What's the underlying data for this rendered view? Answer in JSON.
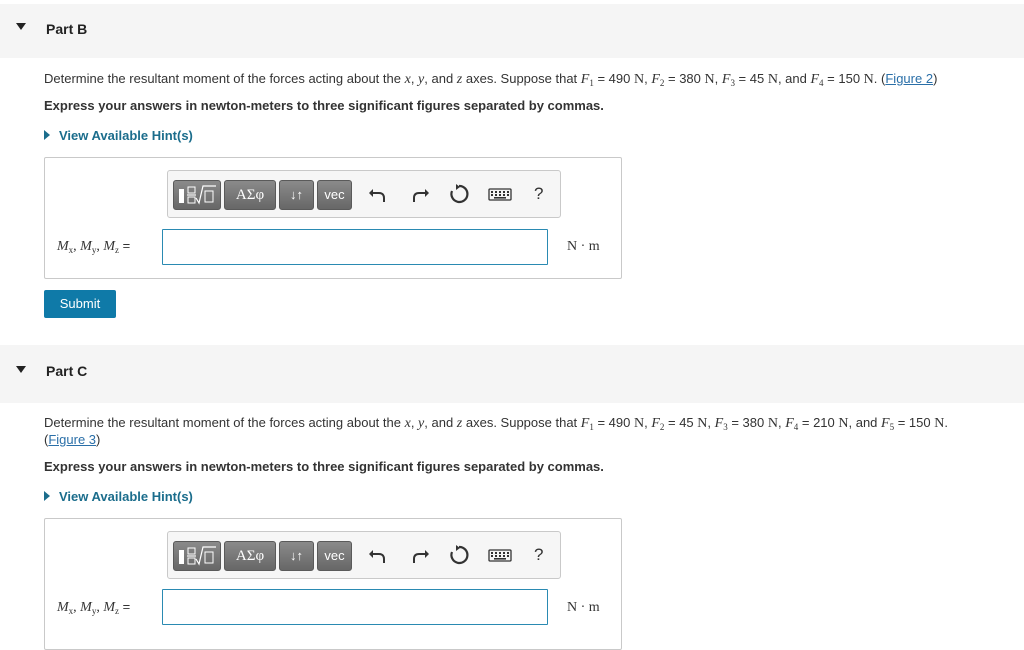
{
  "partB": {
    "title": "Part B",
    "problem": {
      "pre": "Determine the resultant moment of the forces acting about the ",
      "x": "x",
      "comma1": ", ",
      "y": "y",
      "and1": ", and ",
      "z": "z",
      "mid": " axes. Suppose that ",
      "f1": "F",
      "f1sub": "1",
      "f1val": " = 490 ",
      "f2": "F",
      "f2sub": "2",
      "f2val": " = 380 ",
      "f3": "F",
      "f3sub": "3",
      "f3val": " = 45 ",
      "f4": "F",
      "f4sub": "4",
      "f4val": " = 150 ",
      "unitN": "N",
      "sep": ", ",
      "and2": ", and ",
      "end": ". (",
      "figure": "Figure 2",
      "close": ")"
    },
    "instruction": "Express your answers in newton-meters to three significant figures separated by commas.",
    "hint": "View Available Hint(s)",
    "toolbar": {
      "greek": "ΑΣφ",
      "arrows": "↓↑",
      "vec": "vec",
      "help": "?"
    },
    "label": {
      "M": "M",
      "x": "x",
      "y": "y",
      "z": "z",
      "sep": ", ",
      "eq": " ="
    },
    "input_value": "",
    "unit": "N · m",
    "submit": "Submit"
  },
  "partC": {
    "title": "Part C",
    "problem": {
      "pre": "Determine the resultant moment of the forces acting about the ",
      "x": "x",
      "comma1": ", ",
      "y": "y",
      "and1": ", and ",
      "z": "z",
      "mid": " axes. Suppose that ",
      "f1": "F",
      "f1sub": "1",
      "f1val": " = 490 ",
      "f2": "F",
      "f2sub": "2",
      "f2val": " = 45 ",
      "f3": "F",
      "f3sub": "3",
      "f3val": " = 380 ",
      "f4": "F",
      "f4sub": "4",
      "f4val": " = 210 ",
      "f5": "F",
      "f5sub": "5",
      "f5val": " = 150 ",
      "unitN": "N",
      "sep": ", ",
      "and2": ", and ",
      "end": ".",
      "open": "(",
      "figure": "Figure 3",
      "close": ")"
    },
    "instruction": "Express your answers in newton-meters to three significant figures separated by commas.",
    "hint": "View Available Hint(s)",
    "toolbar": {
      "greek": "ΑΣφ",
      "arrows": "↓↑",
      "vec": "vec",
      "help": "?"
    },
    "label": {
      "M": "M",
      "x": "x",
      "y": "y",
      "z": "z",
      "sep": ", ",
      "eq": " ="
    },
    "input_value": "",
    "unit": "N · m"
  },
  "colors": {
    "accent": "#0f7aa8",
    "link": "#2a6fa8",
    "hint": "#1b6d8c",
    "header_bg": "#f5f5f5"
  }
}
